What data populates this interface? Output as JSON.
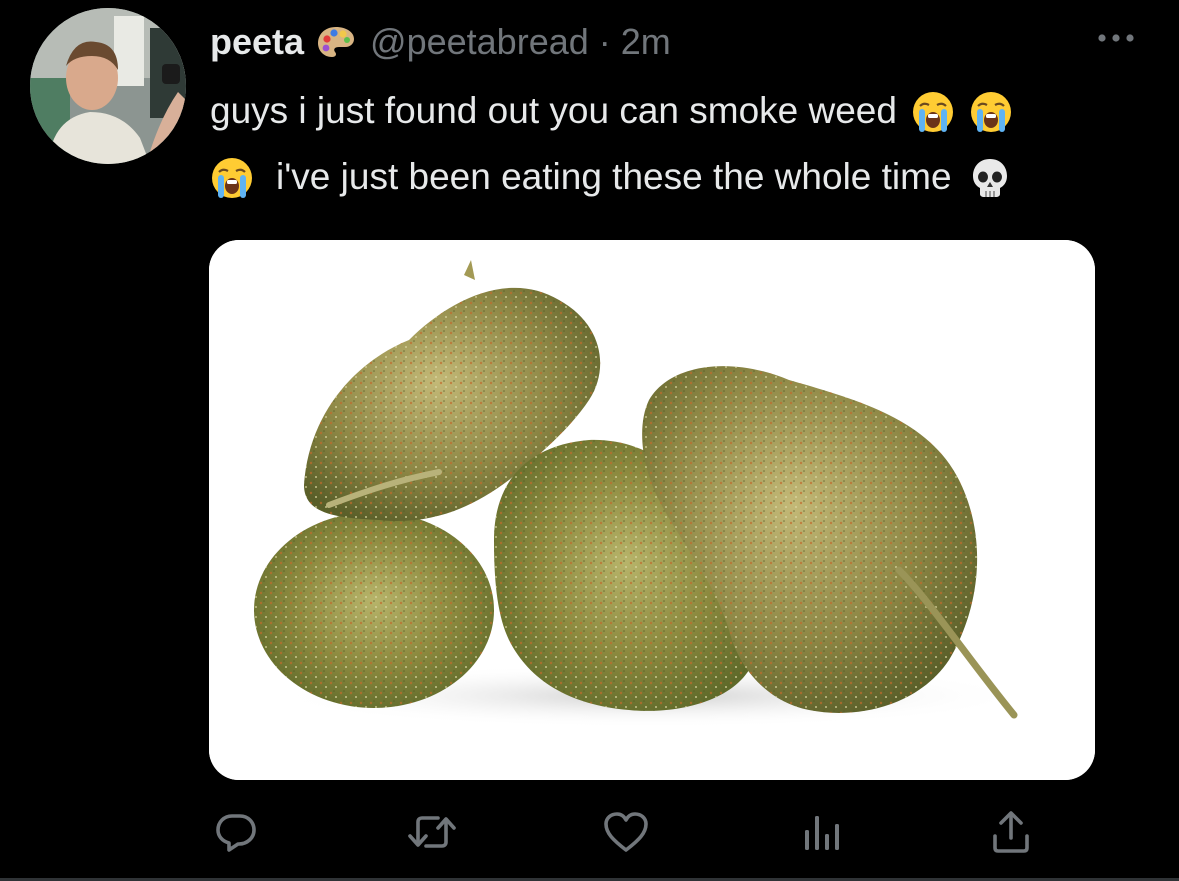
{
  "tweet": {
    "display_name": "peeta",
    "handle": "@peetabread",
    "separator": "·",
    "time": "2m",
    "text_line1": "guys i just found out you can smoke weed",
    "text_line2": "i've just been eating these the whole time"
  },
  "icons": {
    "name_badge": "artist-palette-icon",
    "more": "more-horizontal-icon",
    "emoji_cry": "loudly-crying-face-icon",
    "emoji_skull": "skull-icon",
    "reply": "reply-icon",
    "retweet": "retweet-icon",
    "like": "heart-icon",
    "analytics": "analytics-icon",
    "share": "share-icon"
  },
  "colors": {
    "background": "#000000",
    "primary_text": "#e7e9ea",
    "secondary_text": "#71767b",
    "action_icon": "#71767b",
    "media_background": "#ffffff"
  }
}
